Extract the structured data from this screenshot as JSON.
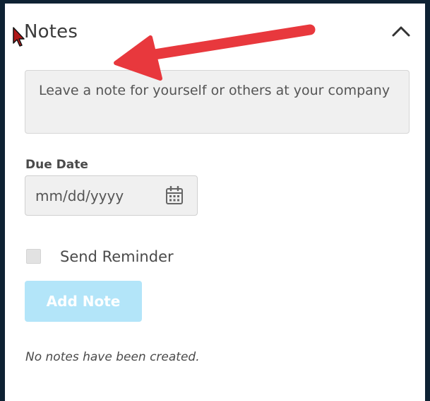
{
  "panel": {
    "title": "Notes",
    "collapse_icon": "chevron-up-icon"
  },
  "note_input": {
    "placeholder": "Leave a note for yourself or others at your company",
    "value": ""
  },
  "due_date": {
    "label": "Due Date",
    "placeholder": "mm/dd/yyyy",
    "icon": "calendar-icon"
  },
  "reminder": {
    "label": "Send Reminder",
    "checked": false
  },
  "add_button": {
    "label": "Add Note",
    "enabled": false
  },
  "empty_state": {
    "message": "No notes have been created."
  },
  "colors": {
    "frame": "#0e2233",
    "input_bg": "#f0f0f0",
    "button_disabled": "#b3e5f9",
    "annotation_arrow": "#e8383d"
  }
}
